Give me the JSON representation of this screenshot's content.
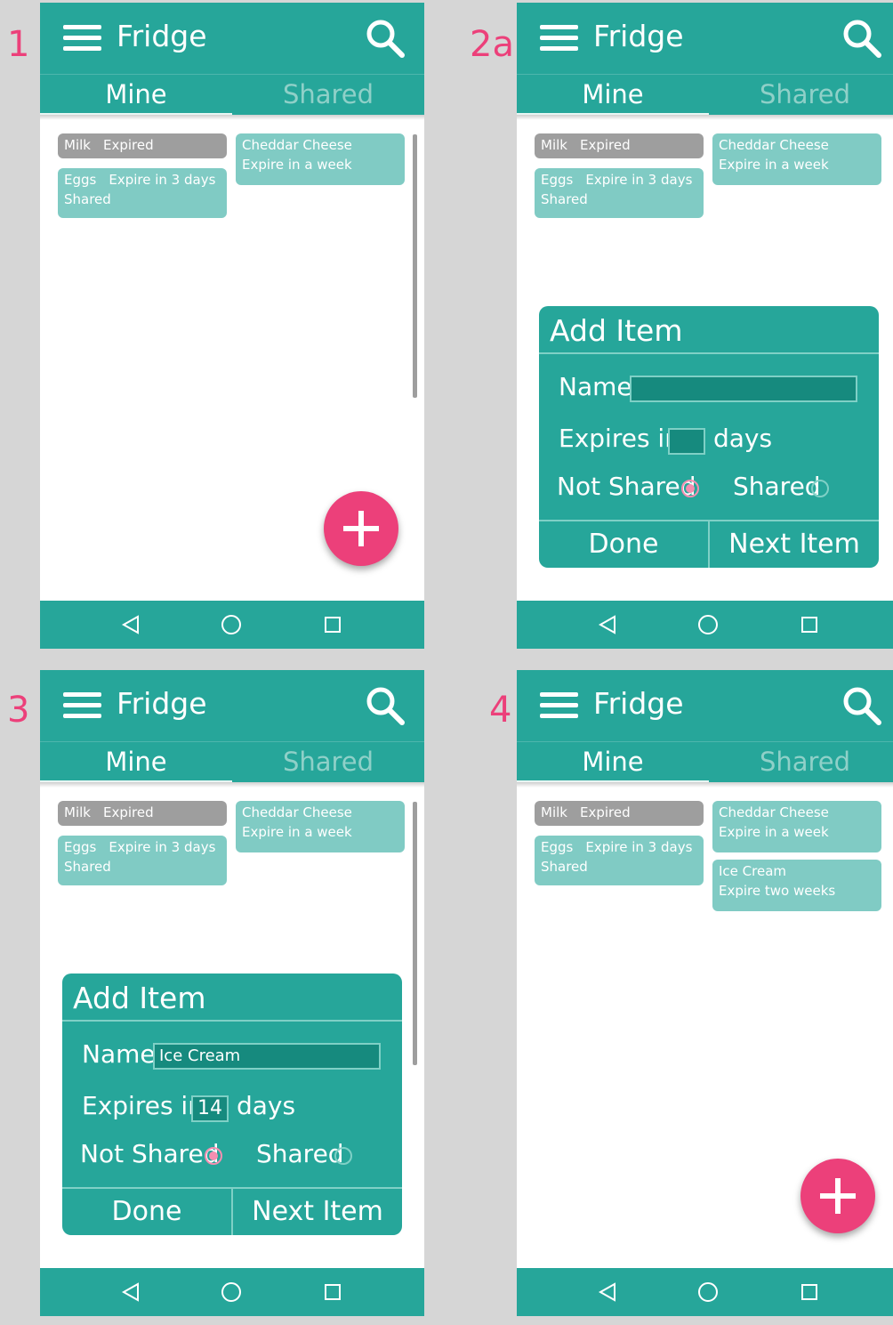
{
  "step_labels": [
    "1",
    "2a",
    "3",
    "4"
  ],
  "app": {
    "title": "Fridge"
  },
  "tabs": {
    "mine": "Mine",
    "shared": "Shared"
  },
  "items": {
    "milk": {
      "name": "Milk",
      "status": "Expired"
    },
    "eggs": {
      "name": "Eggs",
      "status": "Expire in 3 days",
      "note": "Shared"
    },
    "cheddar": {
      "name": "Cheddar Cheese",
      "status": "Expire in a week"
    },
    "icecream": {
      "name": "Ice Cream",
      "status": "Expire two weeks"
    }
  },
  "dialog": {
    "title": "Add Item",
    "name_label": "Name",
    "expires_label": "Expires in",
    "days_label": "days",
    "not_shared_label": "Not Shared",
    "shared_label": "Shared",
    "done_label": "Done",
    "next_label": "Next Item"
  },
  "dialog_filled": {
    "name_value": "Ice Cream",
    "days_value": "14"
  },
  "colors": {
    "primary": "#26a69a",
    "accent": "#ec407a",
    "card_teal": "#80cbc4",
    "card_grey": "#9e9e9e"
  },
  "icons": [
    "menu-icon",
    "search-icon",
    "add-icon",
    "back-icon",
    "home-icon",
    "recents-icon"
  ]
}
